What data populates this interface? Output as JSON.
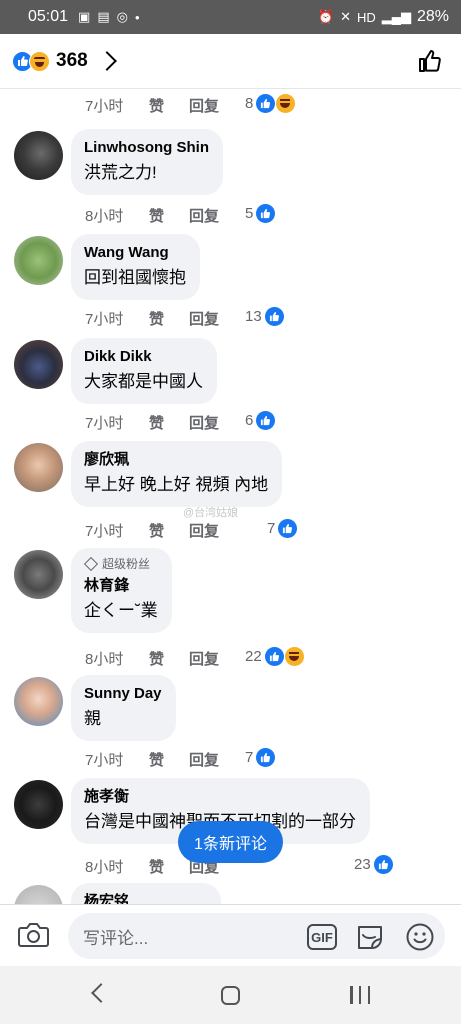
{
  "status_bar": {
    "time": "05:01",
    "left_icons": [
      "image-icon",
      "gallery-icon",
      "messenger-icon",
      "dot-icon"
    ],
    "signal_text": "HD",
    "battery": "28%"
  },
  "header": {
    "reaction_count": "368",
    "reactions": [
      "like",
      "haha"
    ]
  },
  "comments": [
    {
      "name": "",
      "text": "",
      "time": "7小时",
      "like_label": "赞",
      "reply_label": "回复",
      "reaction_count": "8",
      "reactions": [
        "like",
        "haha"
      ]
    },
    {
      "name": "Linwhosong Shin",
      "text": "洪荒之力!",
      "time": "8小时",
      "like_label": "赞",
      "reply_label": "回复",
      "reaction_count": "5",
      "reactions": [
        "like"
      ]
    },
    {
      "name": "Wang Wang",
      "text": "回到祖國懷抱",
      "time": "7小时",
      "like_label": "赞",
      "reply_label": "回复",
      "reaction_count": "13",
      "reactions": [
        "like"
      ]
    },
    {
      "name": "Dikk Dikk",
      "text": "大家都是中國人",
      "time": "7小时",
      "like_label": "赞",
      "reply_label": "回复",
      "reaction_count": "6",
      "reactions": [
        "like"
      ]
    },
    {
      "name": "廖欣珮",
      "text": "早上好 晚上好 視頻 內地",
      "time": "7小时",
      "like_label": "赞",
      "reply_label": "回复",
      "reaction_count": "7",
      "reactions": [
        "like"
      ]
    },
    {
      "badge": "超级粉丝",
      "name": "林育鋒",
      "text": "企くー˘業",
      "time": "8小时",
      "like_label": "赞",
      "reply_label": "回复",
      "reaction_count": "22",
      "reactions": [
        "like",
        "haha"
      ]
    },
    {
      "name": "Sunny Day",
      "text": "親",
      "time": "7小时",
      "like_label": "赞",
      "reply_label": "回复",
      "reaction_count": "7",
      "reactions": [
        "like"
      ]
    },
    {
      "name": "施孝衡",
      "text": "台灣是中國神聖而不可切割的一部分",
      "time": "8小时",
      "like_label": "赞",
      "reply_label": "回复",
      "reaction_count": "23",
      "reactions": [
        "like"
      ]
    },
    {
      "name": "杨宏铭"
    }
  ],
  "watermark": "@台湾姑娘",
  "new_comment_pill": "1条新评论",
  "composer": {
    "placeholder": "写评论...",
    "gif_label": "GIF"
  },
  "colors": {
    "facebook_blue": "#1877f2",
    "bubble_gray": "#f0f2f5",
    "secondary_text": "#65676b",
    "haha_yellow": "#f7b125"
  }
}
